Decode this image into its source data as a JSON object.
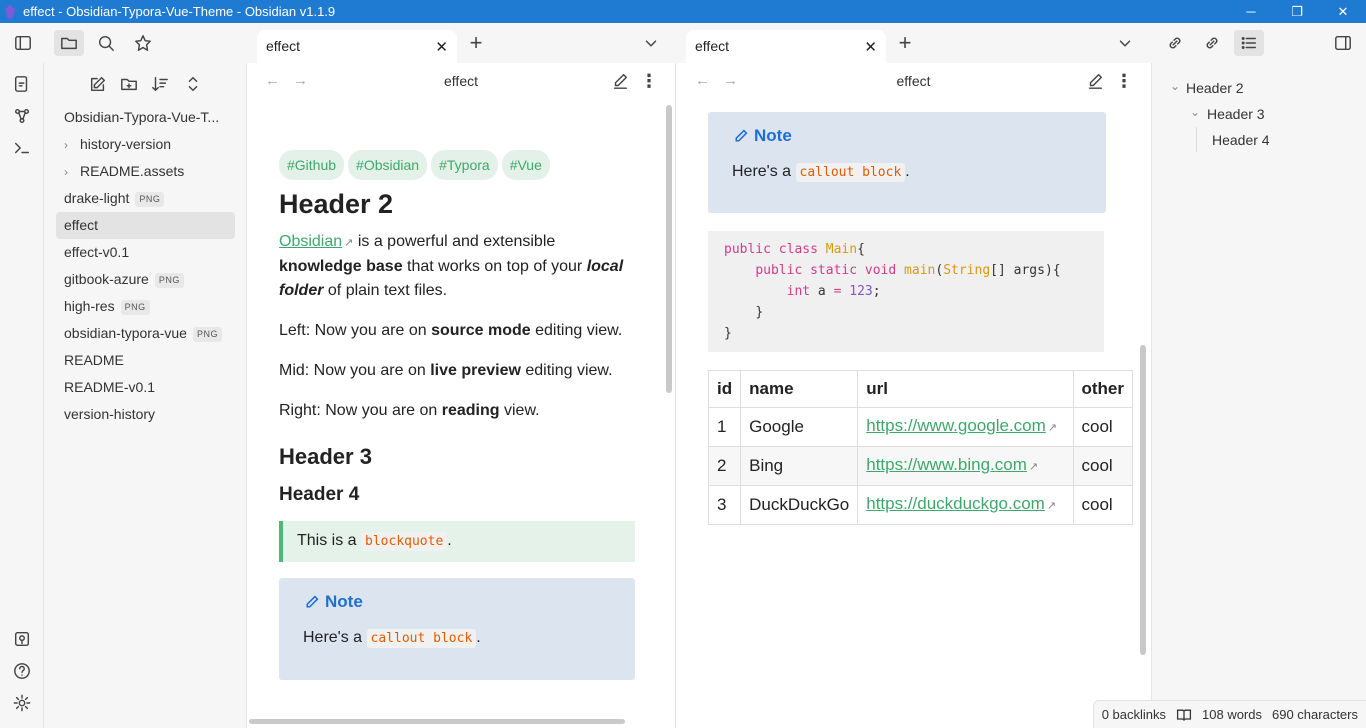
{
  "window": {
    "title": "effect - Obsidian-Typora-Vue-Theme - Obsidian v1.1.9",
    "min": "─",
    "max": "❐",
    "close": "✕"
  },
  "tabs": [
    {
      "label": "effect",
      "close": "✕"
    },
    {
      "label": "effect",
      "close": "✕"
    }
  ],
  "new_tab": "+",
  "tab_list": "⌄",
  "sidebar": {
    "items": [
      {
        "label": "Obsidian-Typora-Vue-T...",
        "type": "root"
      },
      {
        "label": "history-version",
        "type": "folder",
        "chev": "›"
      },
      {
        "label": "README.assets",
        "type": "folder",
        "chev": "›"
      },
      {
        "label": "drake-light",
        "badge": "PNG"
      },
      {
        "label": "effect",
        "active": true
      },
      {
        "label": "effect-v0.1"
      },
      {
        "label": "gitbook-azure",
        "badge": "PNG"
      },
      {
        "label": "high-res",
        "badge": "PNG"
      },
      {
        "label": "obsidian-typora-vue",
        "badge": "PNG"
      },
      {
        "label": "README"
      },
      {
        "label": "README-v0.1"
      },
      {
        "label": "version-history"
      }
    ]
  },
  "left_view": {
    "title": "effect",
    "tags": [
      "#Github",
      "#Obsidian",
      "#Typora",
      "#Vue"
    ],
    "h2": "Header 2",
    "p1_link": "Obsidian",
    "p1_a": " is a powerful and extensible ",
    "p1_b": "knowledge base",
    "p1_c": " that works on top of your ",
    "p1_d": "local folder",
    "p1_e": " of plain text files.",
    "p2_a": "Left: Now you are on ",
    "p2_b": "source mode",
    "p2_c": " editing view.",
    "p3_a": "Mid: Now you are on ",
    "p3_b": "live preview",
    "p3_c": " editing view.",
    "p4_a": "Right: Now you are on ",
    "p4_b": "reading",
    "p4_c": " view.",
    "h3": "Header 3",
    "h4": "Header 4",
    "quote_a": "This is a ",
    "quote_code": "blockquote",
    "quote_b": ".",
    "callout_title": "Note",
    "callout_a": "Here's a ",
    "callout_code": "callout block",
    "callout_b": "."
  },
  "right_view": {
    "title": "effect",
    "callout_title": "Note",
    "callout_a": "Here's a ",
    "callout_code": "callout block",
    "callout_b": ".",
    "code": {
      "l1a": "public",
      "l1b": "class",
      "l1c": "Main",
      "l1d": "{",
      "l2a": "public",
      "l2b": "static",
      "l2c": "void",
      "l2d": "main",
      "l2e": "(",
      "l2f": "String",
      "l2g": "[] args){",
      "l3a": "int",
      "l3b": " a ",
      "l3c": "=",
      "l3d": "123",
      "l3e": ";",
      "l4": "}",
      "l5": "}"
    },
    "table": {
      "headers": [
        "id",
        "name",
        "url",
        "other"
      ],
      "rows": [
        [
          "1",
          "Google",
          "https://www.google.com",
          "cool"
        ],
        [
          "2",
          "Bing",
          "https://www.bing.com",
          "cool"
        ],
        [
          "3",
          "DuckDuckGo",
          "https://duckduckgo.com",
          "cool"
        ]
      ]
    }
  },
  "outline": {
    "h2": "Header 2",
    "h3": "Header 3",
    "h4": "Header 4"
  },
  "status": {
    "backlinks": "0 backlinks",
    "words": "108 words",
    "chars": "690 characters"
  }
}
